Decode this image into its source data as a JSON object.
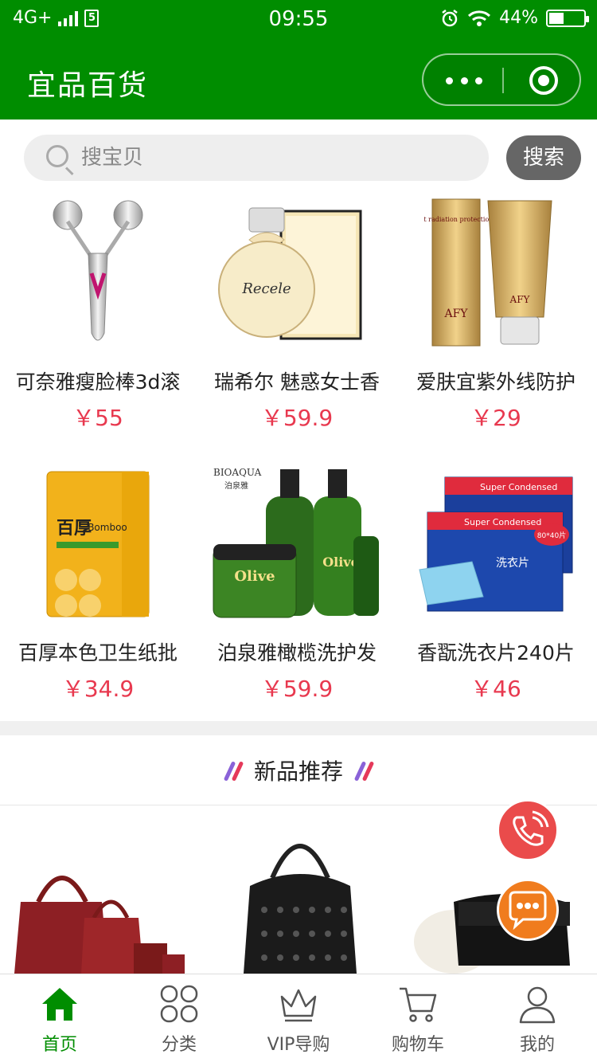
{
  "status_bar": {
    "network": "4G+",
    "time": "09:55",
    "battery": "44%",
    "battery_level": 0.44
  },
  "header": {
    "title": "宜品百货"
  },
  "search": {
    "placeholder": "搜宝贝",
    "button_label": "搜索"
  },
  "products": [
    {
      "name": "可奈雅瘦脸棒3d滚",
      "price": "￥55"
    },
    {
      "name": "瑞希尔 魅惑女士香",
      "price": "￥59.9"
    },
    {
      "name": "爱肤宜紫外线防护",
      "price": "￥29"
    },
    {
      "name": "百厚本色卫生纸批",
      "price": "￥34.9"
    },
    {
      "name": "泊泉雅橄榄洗护发",
      "price": "￥59.9"
    },
    {
      "name": "香翫洗衣片240片",
      "price": "￥46"
    }
  ],
  "product_image_text": {
    "perfume": "Recele",
    "cream_brand": "AFY",
    "cream_label": "Ultraviolet radiation protection CREAM",
    "tissue_brand": "百厚",
    "tissue_label": "Bomboo",
    "olive_brand": "BIOAQUA",
    "olive_brand_cn": "泊泉雅",
    "olive_label": "Olive",
    "laundry_label": "Super Condensed",
    "laundry_cn": "洗衣片",
    "laundry_count": "80*40片"
  },
  "section": {
    "title": "新品推荐"
  },
  "tabs": [
    {
      "label": "首页",
      "icon": "home-icon",
      "active": true
    },
    {
      "label": "分类",
      "icon": "category-icon",
      "active": false
    },
    {
      "label": "VIP导购",
      "icon": "crown-icon",
      "active": false
    },
    {
      "label": "购物车",
      "icon": "cart-icon",
      "active": false
    },
    {
      "label": "我的",
      "icon": "user-icon",
      "active": false
    }
  ],
  "colors": {
    "brand_green": "#008d00",
    "price_red": "#e8394f",
    "phone_red": "#ea4b4b",
    "chat_orange": "#f07c1e"
  }
}
